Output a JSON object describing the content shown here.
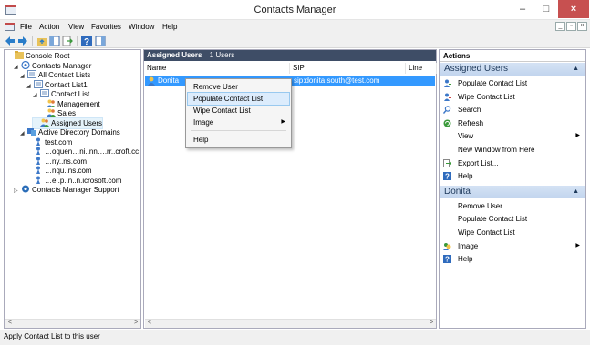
{
  "window": {
    "title": "Contacts Manager",
    "min": "–",
    "max": "□",
    "close": "×"
  },
  "menu": {
    "items": [
      "File",
      "Action",
      "View",
      "Favorites",
      "Window",
      "Help"
    ]
  },
  "mdi": {
    "min": "_",
    "restore": "▫",
    "close": "×"
  },
  "tree": {
    "nodes": [
      {
        "label": "Console Root",
        "depth": 0,
        "expander": ""
      },
      {
        "label": "Contacts Manager",
        "depth": 1,
        "expander": "◢"
      },
      {
        "label": "All Contact Lists",
        "depth": 2,
        "expander": "◢"
      },
      {
        "label": "Contact List1",
        "depth": 3,
        "expander": "◢"
      },
      {
        "label": "Contact List",
        "depth": 4,
        "expander": "◢"
      },
      {
        "label": "Management",
        "depth": 5,
        "expander": ""
      },
      {
        "label": "Sales",
        "depth": 5,
        "expander": ""
      },
      {
        "label": "Assigned Users",
        "depth": 4,
        "expander": ""
      },
      {
        "label": "Active Directory Domains",
        "depth": 2,
        "expander": "◢"
      },
      {
        "label": "test.com",
        "depth": 3,
        "expander": ""
      },
      {
        "label": "…oquen…ni..nn….rr..croft.cc",
        "depth": 3,
        "expander": ""
      },
      {
        "label": "…ny..ns.com",
        "depth": 3,
        "expander": ""
      },
      {
        "label": "…nqu..ns.com",
        "depth": 3,
        "expander": ""
      },
      {
        "label": "…e..p..n..n.icrosoft.com",
        "depth": 3,
        "expander": ""
      },
      {
        "label": "Contacts Manager Support",
        "depth": 1,
        "expander": "▷"
      }
    ]
  },
  "list": {
    "header_title": "Assigned Users",
    "header_count": "1 Users",
    "columns": [
      "Name",
      "SIP",
      "Line"
    ],
    "rows": [
      {
        "name": "Donita",
        "sip": "sip:donita.south@test.com",
        "line": ""
      }
    ]
  },
  "context_menu": {
    "items": [
      {
        "label": "Remove User",
        "highlighted": false,
        "submenu": false
      },
      {
        "label": "Populate Contact List",
        "highlighted": true,
        "submenu": false
      },
      {
        "label": "Wipe Contact List",
        "highlighted": false,
        "submenu": false
      },
      {
        "label": "Image",
        "highlighted": false,
        "submenu": true
      },
      {
        "label": "Help",
        "highlighted": false,
        "submenu": false
      }
    ]
  },
  "actions": {
    "title": "Actions",
    "sections": [
      {
        "title": "Assigned Users",
        "items": [
          {
            "label": "Populate Contact List",
            "icon": "user-add-icon",
            "submenu": false
          },
          {
            "label": "Wipe Contact List",
            "icon": "user-remove-icon",
            "submenu": false
          },
          {
            "label": "Search",
            "icon": "search-icon",
            "submenu": false
          },
          {
            "label": "Refresh",
            "icon": "refresh-icon",
            "submenu": false
          },
          {
            "label": "View",
            "icon": "",
            "submenu": true
          },
          {
            "label": "New Window from Here",
            "icon": "",
            "submenu": false
          },
          {
            "label": "Export List...",
            "icon": "export-icon",
            "submenu": false
          },
          {
            "label": "Help",
            "icon": "help-icon",
            "submenu": false
          }
        ]
      },
      {
        "title": "Donita",
        "items": [
          {
            "label": "Remove User",
            "icon": "",
            "submenu": false
          },
          {
            "label": "Populate Contact List",
            "icon": "",
            "submenu": false
          },
          {
            "label": "Wipe Contact List",
            "icon": "",
            "submenu": false
          },
          {
            "label": "Image",
            "icon": "image-icon",
            "submenu": true
          },
          {
            "label": "Help",
            "icon": "help-icon",
            "submenu": false
          }
        ]
      }
    ]
  },
  "status": {
    "text": "Apply Contact List to this user"
  },
  "colors": {
    "list_header": "#3e4d66",
    "selection": "#3399ff",
    "section_header": "#c2d5ee",
    "close_button": "#c75050"
  }
}
